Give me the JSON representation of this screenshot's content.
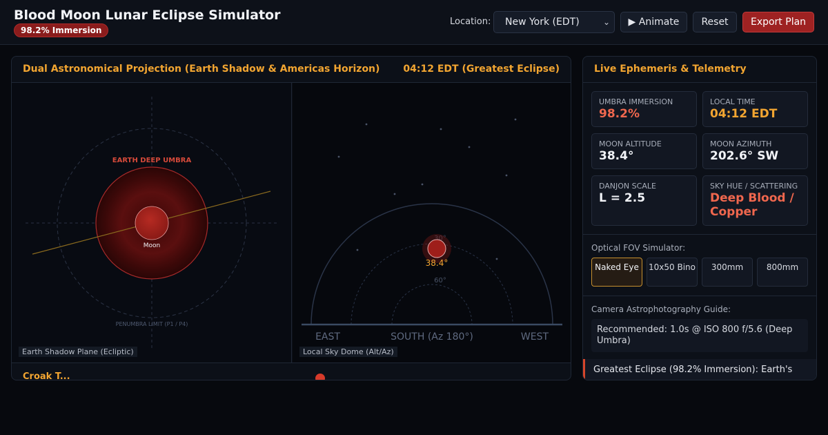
{
  "app": {
    "title": "Blood Moon Lunar Eclipse Simulator",
    "badge": "98.2% Immersion"
  },
  "toolbar": {
    "location_label": "Location:",
    "location_value": "New York (EDT)",
    "animate_label": "▶ Animate",
    "reset_label": "Reset",
    "export_label": "Export Plan"
  },
  "projection": {
    "title": "Dual Astronomical Projection (Earth Shadow & Americas Horizon)",
    "time": "04:12 EDT (Greatest Eclipse)",
    "shadow_view": {
      "umbra_label": "EARTH DEEP UMBRA",
      "moon_label": "Moon",
      "penumbra_label": "PENUMBRA LIMIT (P1 / P4)",
      "caption": "Earth Shadow Plane (Ecliptic)"
    },
    "sky_view": {
      "moon_altitude_label": "38.4°",
      "ring_label_60": "60°",
      "ring_label_30": "30°",
      "east": "EAST",
      "south": "SOUTH (Az 180°)",
      "west": "WEST",
      "caption": "Local Sky Dome (Alt/Az)"
    },
    "strip_label": "Croak T..."
  },
  "telemetry": {
    "title": "Live Ephemeris & Telemetry",
    "cards": [
      {
        "label": "UMBRA IMMERSION",
        "value": "98.2%"
      },
      {
        "label": "LOCAL TIME",
        "value": "04:12 EDT"
      },
      {
        "label": "MOON ALTITUDE",
        "value": "38.4°"
      },
      {
        "label": "MOON AZIMUTH",
        "value": "202.6° SW"
      },
      {
        "label": "DANJON SCALE",
        "value": "L = 2.5"
      },
      {
        "label": "SKY HUE / SCATTERING",
        "value": "Deep Blood / Copper"
      }
    ],
    "fov_label": "Optical FOV Simulator:",
    "fov_options": [
      {
        "label": "Naked Eye"
      },
      {
        "label": "10x50 Bino"
      },
      {
        "label": "300mm"
      },
      {
        "label": "800mm"
      }
    ],
    "camera_label": "Camera Astrophotography Guide:",
    "camera_recommendation": "Recommended: 1.0s @ ISO 800 f/5.6 (Deep Umbra)",
    "alert": "Greatest Eclipse (98.2% Immersion): Earth's"
  },
  "colors": {
    "accent": "#f2a531",
    "danger": "#d6452a",
    "umbra": "#7a1414"
  }
}
